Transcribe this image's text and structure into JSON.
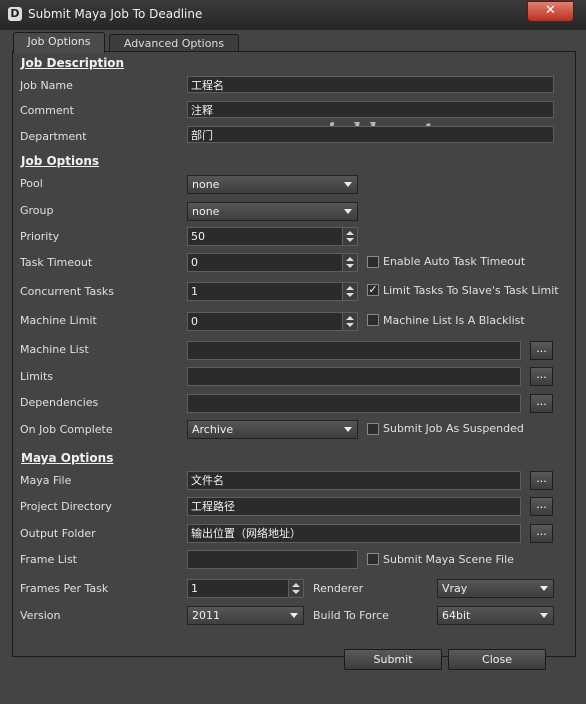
{
  "window": {
    "title": "Submit Maya Job To Deadline",
    "app_icon": "deadline-icon",
    "close_glyph": "✕"
  },
  "tabs": [
    {
      "label": "Job Options",
      "active": true
    },
    {
      "label": "Advanced Options",
      "active": false
    }
  ],
  "watermark": "www.niubb.net",
  "job_description": {
    "heading": "Job Description",
    "job_name_label": "Job Name",
    "job_name_value": "工程名",
    "comment_label": "Comment",
    "comment_value": "注释",
    "department_label": "Department",
    "department_value": "部门"
  },
  "job_options": {
    "heading": "Job Options",
    "pool_label": "Pool",
    "pool_value": "none",
    "group_label": "Group",
    "group_value": "none",
    "priority_label": "Priority",
    "priority_value": "50",
    "task_timeout_label": "Task Timeout",
    "task_timeout_value": "0",
    "auto_timeout_label": "Enable Auto Task Timeout",
    "auto_timeout_checked": false,
    "concurrent_label": "Concurrent Tasks",
    "concurrent_value": "1",
    "limit_slave_label": "Limit Tasks To Slave's Task Limit",
    "limit_slave_checked": true,
    "machine_limit_label": "Machine Limit",
    "machine_limit_value": "0",
    "blacklist_label": "Machine List Is A Blacklist",
    "blacklist_checked": false,
    "machine_list_label": "Machine List",
    "machine_list_value": "",
    "limits_label": "Limits",
    "limits_value": "",
    "dependencies_label": "Dependencies",
    "dependencies_value": "",
    "on_complete_label": "On Job Complete",
    "on_complete_value": "Archive",
    "suspended_label": "Submit Job As Suspended",
    "suspended_checked": false,
    "browse_label": "..."
  },
  "maya_options": {
    "heading": "Maya Options",
    "maya_file_label": "Maya File",
    "maya_file_value": "文件名",
    "project_dir_label": "Project Directory",
    "project_dir_value": "工程路径",
    "output_folder_label": "Output Folder",
    "output_folder_value": "输出位置（网络地址）",
    "frame_list_label": "Frame List",
    "frame_list_value": "",
    "submit_scene_label": "Submit Maya Scene File",
    "submit_scene_checked": false,
    "frames_per_task_label": "Frames Per Task",
    "frames_per_task_value": "1",
    "renderer_label": "Renderer",
    "renderer_value": "Vray",
    "version_label": "Version",
    "version_value": "2011",
    "build_label": "Build To Force",
    "build_value": "64bit"
  },
  "footer": {
    "submit_label": "Submit",
    "close_label": "Close"
  }
}
